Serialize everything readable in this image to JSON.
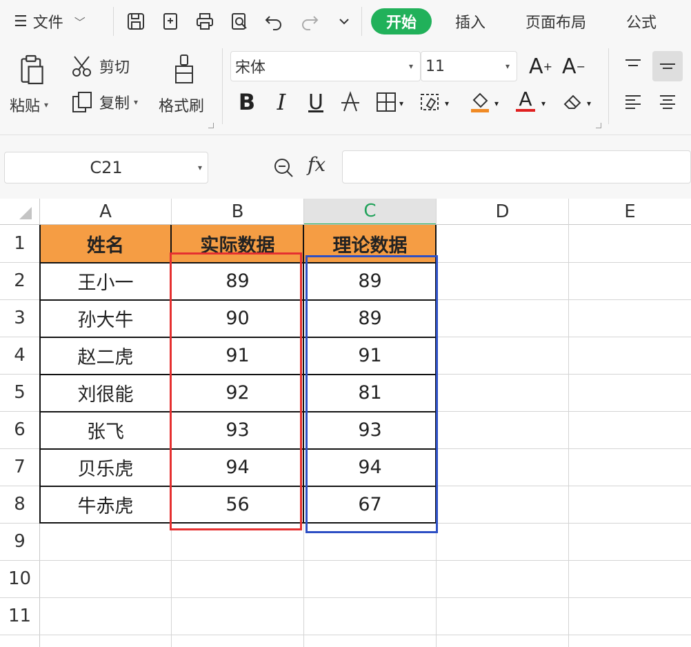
{
  "tabs": {
    "menu_label": "文件",
    "items": [
      {
        "label": "开始",
        "active": true
      },
      {
        "label": "插入",
        "active": false
      },
      {
        "label": "页面布局",
        "active": false
      },
      {
        "label": "公式",
        "active": false
      }
    ]
  },
  "ribbon": {
    "paste_label": "粘贴",
    "cut_label": "剪切",
    "copy_label": "复制",
    "format_painter_label": "格式刷",
    "font_name": "宋体",
    "font_size": "11",
    "bold": "B",
    "italic": "I",
    "underline": "U",
    "grow_font": "A",
    "shrink_font": "A",
    "font_color": "A",
    "fill_color": "#f08a24",
    "font_color_hex": "#e02020"
  },
  "formula_bar": {
    "name_box": "C21",
    "fx_label": "fx",
    "value": ""
  },
  "sheet": {
    "columns": [
      "A",
      "B",
      "C",
      "D",
      "E"
    ],
    "selected_column": "C",
    "rows": [
      "1",
      "2",
      "3",
      "4",
      "5",
      "6",
      "7",
      "8",
      "9",
      "10",
      "11"
    ],
    "header": [
      "姓名",
      "实际数据",
      "理论数据"
    ],
    "data": [
      [
        "王小一",
        "89",
        "89"
      ],
      [
        "孙大牛",
        "90",
        "89"
      ],
      [
        "赵二虎",
        "91",
        "91"
      ],
      [
        "刘很能",
        "92",
        "81"
      ],
      [
        "张飞",
        "93",
        "93"
      ],
      [
        "贝乐虎",
        "94",
        "94"
      ],
      [
        "牛赤虎",
        "56",
        "67"
      ]
    ],
    "header_fill": "#f59d44",
    "highlight_red": "#e53030",
    "highlight_blue": "#2d4fc4"
  }
}
